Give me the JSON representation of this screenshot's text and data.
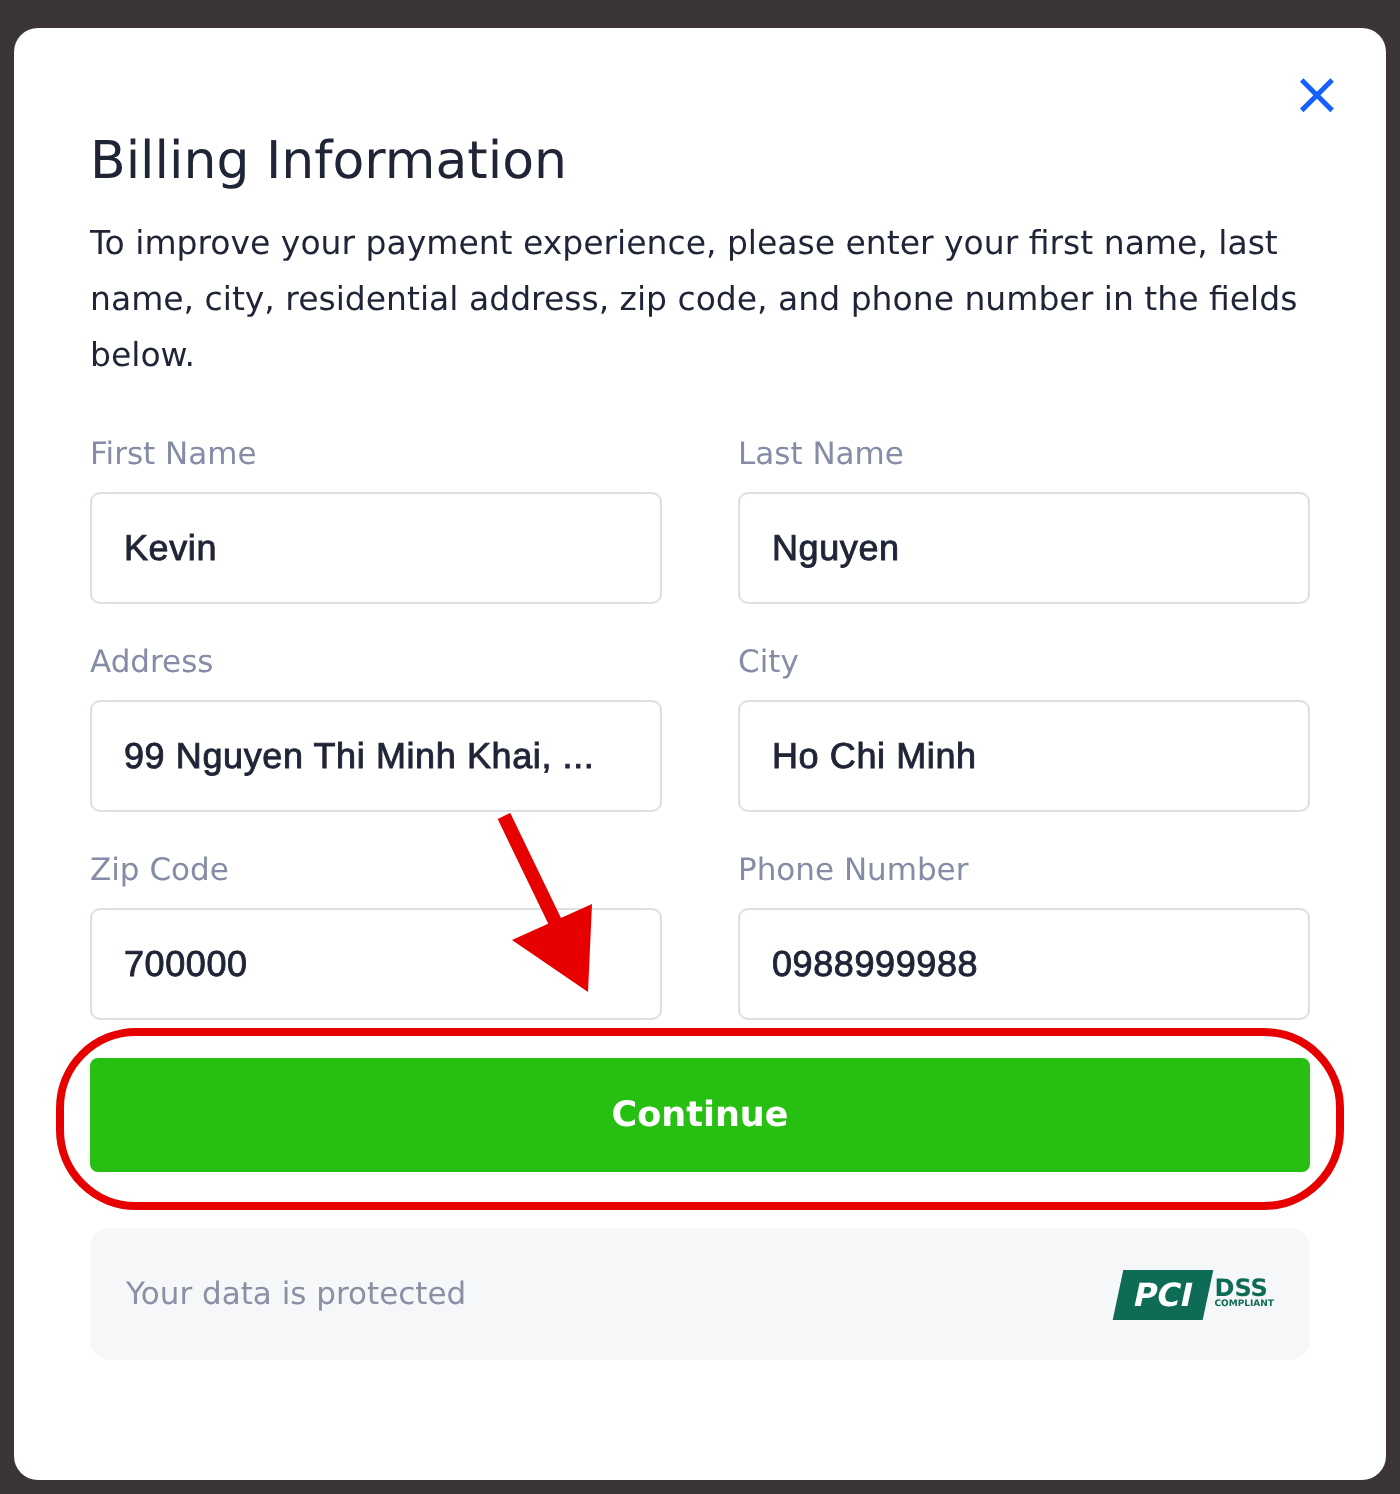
{
  "dialog": {
    "title": "Billing Information",
    "close": "×",
    "description": "To improve your payment experience, please enter your first name, last name, city, residential address, zip code, and phone number in the fields below."
  },
  "fields": [
    {
      "label": "First Name",
      "value": "Kevin"
    },
    {
      "label": "Last Name",
      "value": "Nguyen"
    },
    {
      "label": "Address",
      "value": "99 Nguyen Thi Minh Khai, ..."
    },
    {
      "label": "City",
      "value": "Ho Chi Minh"
    },
    {
      "label": "Zip Code",
      "value": "700000"
    },
    {
      "label": "Phone Number",
      "value": "0988999988"
    }
  ],
  "primary_button": "Continue",
  "footer": {
    "note": "Your data is protected",
    "badge": {
      "mark": "PCI",
      "standard": "DSS",
      "status": "COMPLIANT"
    }
  }
}
